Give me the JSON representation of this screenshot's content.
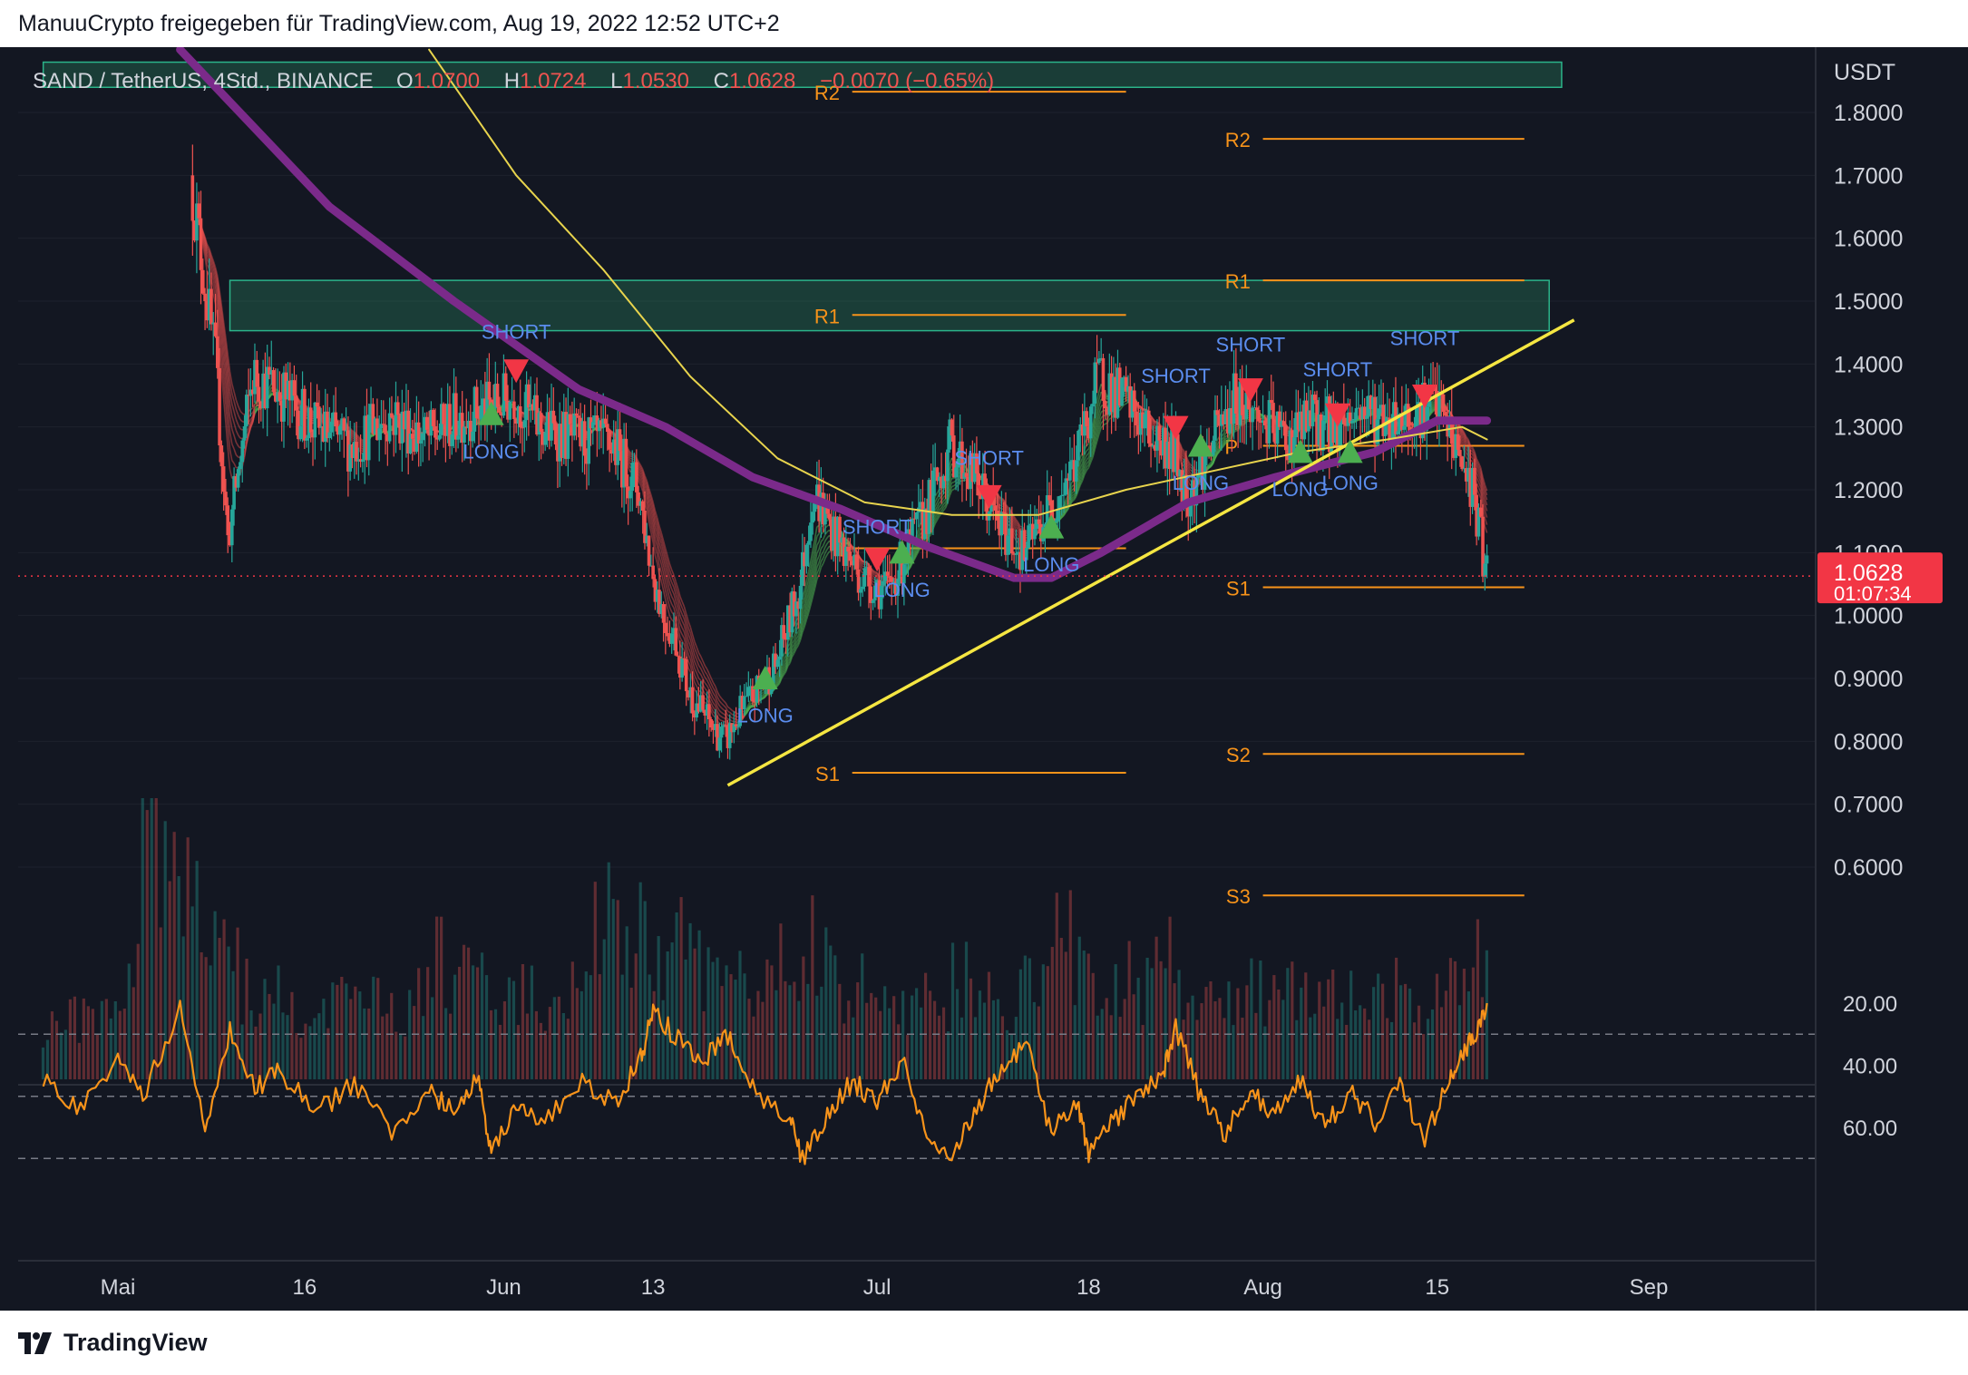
{
  "header": {
    "attribution": "ManuuCrypto freigegeben für TradingView.com, Aug 19, 2022 12:52 UTC+2"
  },
  "legend": {
    "symbol": "SAND / TetherUS, 4Std., BINANCE",
    "o_label": "O",
    "o_value": "1.0700",
    "h_label": "H",
    "h_value": "1.0724",
    "l_label": "L",
    "l_value": "1.0530",
    "c_label": "C",
    "c_value": "1.0628",
    "change": "−0.0070 (−0.65%)"
  },
  "price_axis": {
    "currency": "USDT",
    "ticks": [
      "1.8000",
      "1.7000",
      "1.6000",
      "1.5000",
      "1.4000",
      "1.3000",
      "1.2000",
      "1.1000",
      "1.0000",
      "0.9000",
      "0.8000",
      "0.7000",
      "0.6000"
    ],
    "current_price": "1.0628",
    "countdown": "01:07:34"
  },
  "rsi_axis": {
    "ticks": [
      "60.00",
      "40.00",
      "20.00"
    ]
  },
  "time_axis": {
    "ticks": [
      "Mai",
      "16",
      "Jun",
      "13",
      "Jul",
      "18",
      "Aug",
      "15",
      "Sep"
    ]
  },
  "footer": {
    "brand": "TradingView"
  },
  "colors": {
    "background": "#131722",
    "bull": "#26a69a",
    "bear": "#ef5350",
    "pivot": "#f7931a",
    "signal_text": "#5b8def",
    "trendline": "#f5e642",
    "ma_purple": "#7b2a8a",
    "ma_yellow": "#e8d44d",
    "rsi": "#f7931a",
    "last_price": "#f23645"
  },
  "chart_data": {
    "type": "candlestick",
    "title": "SAND / TetherUS, 4Std., BINANCE",
    "ylabel": "USDT",
    "ylim": [
      0.52,
      1.88
    ],
    "x": [
      "2022-05-01",
      "2022-09-01"
    ],
    "price_path": [
      [
        "2022-04-25",
        1.95
      ],
      [
        "2022-04-30",
        1.92
      ],
      [
        "2022-05-04",
        1.9
      ],
      [
        "2022-05-06",
        1.85
      ],
      [
        "2022-05-07",
        1.7
      ],
      [
        "2022-05-08",
        1.55
      ],
      [
        "2022-05-09",
        1.4
      ],
      [
        "2022-05-10",
        1.12
      ],
      [
        "2022-05-11",
        1.25
      ],
      [
        "2022-05-12",
        1.38
      ],
      [
        "2022-05-14",
        1.36
      ],
      [
        "2022-05-17",
        1.3
      ],
      [
        "2022-05-20",
        1.27
      ],
      [
        "2022-05-23",
        1.32
      ],
      [
        "2022-05-26",
        1.28
      ],
      [
        "2022-05-29",
        1.32
      ],
      [
        "2022-05-31",
        1.33
      ],
      [
        "2022-06-02",
        1.35
      ],
      [
        "2022-06-04",
        1.3
      ],
      [
        "2022-06-07",
        1.28
      ],
      [
        "2022-06-10",
        1.27
      ],
      [
        "2022-06-12",
        1.2
      ],
      [
        "2022-06-13",
        1.08
      ],
      [
        "2022-06-14",
        1.0
      ],
      [
        "2022-06-15",
        0.96
      ],
      [
        "2022-06-16",
        0.88
      ],
      [
        "2022-06-18",
        0.82
      ],
      [
        "2022-06-19",
        0.8
      ],
      [
        "2022-06-20",
        0.84
      ],
      [
        "2022-06-23",
        0.92
      ],
      [
        "2022-06-25",
        1.05
      ],
      [
        "2022-06-26",
        1.2
      ],
      [
        "2022-06-28",
        1.12
      ],
      [
        "2022-06-30",
        1.06
      ],
      [
        "2022-07-02",
        1.04
      ],
      [
        "2022-07-05",
        1.16
      ],
      [
        "2022-07-07",
        1.27
      ],
      [
        "2022-07-09",
        1.22
      ],
      [
        "2022-07-11",
        1.14
      ],
      [
        "2022-07-13",
        1.1
      ],
      [
        "2022-07-15",
        1.17
      ],
      [
        "2022-07-17",
        1.24
      ],
      [
        "2022-07-19",
        1.38
      ],
      [
        "2022-07-21",
        1.34
      ],
      [
        "2022-07-23",
        1.29
      ],
      [
        "2022-07-25",
        1.26
      ],
      [
        "2022-07-26",
        1.19
      ],
      [
        "2022-07-28",
        1.27
      ],
      [
        "2022-07-30",
        1.35
      ],
      [
        "2022-08-01",
        1.31
      ],
      [
        "2022-08-03",
        1.28
      ],
      [
        "2022-08-05",
        1.31
      ],
      [
        "2022-08-07",
        1.3
      ],
      [
        "2022-08-09",
        1.33
      ],
      [
        "2022-08-11",
        1.31
      ],
      [
        "2022-08-13",
        1.32
      ],
      [
        "2022-08-15",
        1.34
      ],
      [
        "2022-08-16",
        1.3
      ],
      [
        "2022-08-17",
        1.25
      ],
      [
        "2022-08-18",
        1.2
      ],
      [
        "2022-08-18T20:00",
        1.1
      ],
      [
        "2022-08-19",
        1.0628
      ]
    ],
    "ma_slow": [
      [
        "2022-05-06",
        1.9
      ],
      [
        "2022-05-18",
        1.65
      ],
      [
        "2022-05-28",
        1.5
      ],
      [
        "2022-06-07",
        1.36
      ],
      [
        "2022-06-14",
        1.3
      ],
      [
        "2022-06-21",
        1.22
      ],
      [
        "2022-06-28",
        1.17
      ],
      [
        "2022-07-05",
        1.11
      ],
      [
        "2022-07-12",
        1.06
      ],
      [
        "2022-07-15",
        1.06
      ],
      [
        "2022-07-19",
        1.1
      ],
      [
        "2022-07-26",
        1.18
      ],
      [
        "2022-08-02",
        1.22
      ],
      [
        "2022-08-10",
        1.26
      ],
      [
        "2022-08-15",
        1.31
      ],
      [
        "2022-08-19",
        1.31
      ]
    ],
    "ma_yellow": [
      [
        "2022-05-26",
        1.9
      ],
      [
        "2022-06-02",
        1.7
      ],
      [
        "2022-06-09",
        1.55
      ],
      [
        "2022-06-16",
        1.38
      ],
      [
        "2022-06-23",
        1.25
      ],
      [
        "2022-06-30",
        1.18
      ],
      [
        "2022-07-07",
        1.16
      ],
      [
        "2022-07-14",
        1.16
      ],
      [
        "2022-07-21",
        1.2
      ],
      [
        "2022-07-28",
        1.23
      ],
      [
        "2022-08-04",
        1.26
      ],
      [
        "2022-08-11",
        1.28
      ],
      [
        "2022-08-17",
        1.3
      ],
      [
        "2022-08-19",
        1.28
      ]
    ],
    "supply_zones": [
      {
        "x0": "2022-04-25",
        "x1": "2022-08-25",
        "y0": 1.84,
        "y1": 1.88
      },
      {
        "x0": "2022-05-10",
        "x1": "2022-08-24",
        "y0": 1.453,
        "y1": 1.533
      }
    ],
    "trendline": {
      "x0": "2022-06-19",
      "y0": 0.73,
      "x1": "2022-08-26",
      "y1": 1.47
    },
    "pivots": [
      {
        "label": "R2",
        "x0": "2022-06-29",
        "x1": "2022-07-21",
        "y": 1.833,
        "text_x": "2022-06-28"
      },
      {
        "label": "R1",
        "x0": "2022-06-29",
        "x1": "2022-07-21",
        "y": 1.478,
        "text_x": "2022-06-28"
      },
      {
        "label": "P",
        "x0": "2022-06-29",
        "x1": "2022-07-21",
        "y": 1.107,
        "text_x": "2022-06-29"
      },
      {
        "label": "S1",
        "x0": "2022-06-29",
        "x1": "2022-07-21",
        "y": 0.75,
        "text_x": "2022-06-28"
      },
      {
        "label": "R2",
        "x0": "2022-08-01",
        "x1": "2022-08-22",
        "y": 1.758,
        "text_x": "2022-07-31"
      },
      {
        "label": "R1",
        "x0": "2022-08-01",
        "x1": "2022-08-22",
        "y": 1.533,
        "text_x": "2022-07-31"
      },
      {
        "label": "P",
        "x0": "2022-08-01",
        "x1": "2022-08-22",
        "y": 1.27,
        "text_x": "2022-07-30"
      },
      {
        "label": "S1",
        "x0": "2022-08-01",
        "x1": "2022-08-22",
        "y": 1.045,
        "text_x": "2022-07-31"
      },
      {
        "label": "S2",
        "x0": "2022-08-01",
        "x1": "2022-08-22",
        "y": 0.78,
        "text_x": "2022-07-31"
      },
      {
        "label": "S3",
        "x0": "2022-08-01",
        "x1": "2022-08-22",
        "y": 0.555,
        "text_x": "2022-07-31"
      }
    ],
    "signals": [
      {
        "type": "LONG",
        "x": "2022-05-31",
        "y": 1.32,
        "label_y": 1.25
      },
      {
        "type": "SHORT",
        "x": "2022-06-02",
        "y": 1.39,
        "label_y": 1.44
      },
      {
        "type": "LONG",
        "x": "2022-06-22",
        "y": 0.9,
        "label_y": 0.83
      },
      {
        "type": "SHORT",
        "x": "2022-07-01",
        "y": 1.09,
        "label_y": 1.13
      },
      {
        "type": "LONG",
        "x": "2022-07-03",
        "y": 1.1,
        "label_y": 1.03
      },
      {
        "type": "SHORT",
        "x": "2022-07-10",
        "y": 1.19,
        "label_y": 1.24
      },
      {
        "type": "LONG",
        "x": "2022-07-15",
        "y": 1.14,
        "label_y": 1.07
      },
      {
        "type": "SHORT",
        "x": "2022-07-25",
        "y": 1.3,
        "label_y": 1.37
      },
      {
        "type": "LONG",
        "x": "2022-07-27",
        "y": 1.27,
        "label_y": 1.2
      },
      {
        "type": "SHORT",
        "x": "2022-07-31",
        "y": 1.36,
        "label_y": 1.42
      },
      {
        "type": "LONG",
        "x": "2022-08-04",
        "y": 1.26,
        "label_y": 1.19
      },
      {
        "type": "SHORT",
        "x": "2022-08-07",
        "y": 1.32,
        "label_y": 1.38
      },
      {
        "type": "LONG",
        "x": "2022-08-08",
        "y": 1.26,
        "label_y": 1.2
      },
      {
        "type": "SHORT",
        "x": "2022-08-14",
        "y": 1.35,
        "label_y": 1.43
      }
    ],
    "volume": [
      0.18,
      0.22,
      0.2,
      0.35,
      0.95,
      0.8,
      0.6,
      0.45,
      0.3,
      0.28,
      0.26,
      0.24,
      0.3,
      0.28,
      0.25,
      0.3,
      0.4,
      0.34,
      0.28,
      0.3,
      0.22,
      0.35,
      0.6,
      0.55,
      0.5,
      0.45,
      0.4,
      0.38,
      0.35,
      0.3,
      0.42,
      0.5,
      0.35,
      0.32,
      0.3,
      0.28,
      0.26,
      0.35,
      0.3,
      0.28,
      0.32,
      0.5,
      0.4,
      0.3,
      0.35,
      0.4,
      0.3,
      0.28,
      0.26,
      0.3,
      0.35,
      0.3,
      0.28,
      0.3,
      0.32,
      0.3,
      0.28,
      0.3,
      0.4
    ],
    "rsi": {
      "ylim": [
        18,
        74
      ],
      "bands": [
        70,
        50,
        30
      ],
      "values": [
        [
          "2022-04-25",
          45
        ],
        [
          "2022-04-28",
          55
        ],
        [
          "2022-05-01",
          38
        ],
        [
          "2022-05-03",
          50
        ],
        [
          "2022-05-06",
          22
        ],
        [
          "2022-05-08",
          60
        ],
        [
          "2022-05-10",
          28
        ],
        [
          "2022-05-12",
          47
        ],
        [
          "2022-05-14",
          42
        ],
        [
          "2022-05-17",
          55
        ],
        [
          "2022-05-20",
          46
        ],
        [
          "2022-05-23",
          62
        ],
        [
          "2022-05-26",
          48
        ],
        [
          "2022-05-28",
          55
        ],
        [
          "2022-05-30",
          44
        ],
        [
          "2022-05-31",
          70
        ],
        [
          "2022-06-02",
          52
        ],
        [
          "2022-06-04",
          60
        ],
        [
          "2022-06-07",
          45
        ],
        [
          "2022-06-10",
          52
        ],
        [
          "2022-06-12",
          38
        ],
        [
          "2022-06-13",
          22
        ],
        [
          "2022-06-15",
          32
        ],
        [
          "2022-06-17",
          38
        ],
        [
          "2022-06-19",
          30
        ],
        [
          "2022-06-21",
          48
        ],
        [
          "2022-06-24",
          58
        ],
        [
          "2022-06-25",
          70
        ],
        [
          "2022-06-27",
          56
        ],
        [
          "2022-06-29",
          45
        ],
        [
          "2022-07-01",
          52
        ],
        [
          "2022-07-03",
          38
        ],
        [
          "2022-07-05",
          62
        ],
        [
          "2022-07-07",
          68
        ],
        [
          "2022-07-09",
          55
        ],
        [
          "2022-07-11",
          40
        ],
        [
          "2022-07-13",
          34
        ],
        [
          "2022-07-15",
          62
        ],
        [
          "2022-07-17",
          52
        ],
        [
          "2022-07-18",
          68
        ],
        [
          "2022-07-20",
          58
        ],
        [
          "2022-07-22",
          50
        ],
        [
          "2022-07-24",
          42
        ],
        [
          "2022-07-25",
          28
        ],
        [
          "2022-07-27",
          50
        ],
        [
          "2022-07-29",
          62
        ],
        [
          "2022-07-31",
          48
        ],
        [
          "2022-08-02",
          56
        ],
        [
          "2022-08-04",
          45
        ],
        [
          "2022-08-06",
          60
        ],
        [
          "2022-08-08",
          48
        ],
        [
          "2022-08-10",
          58
        ],
        [
          "2022-08-12",
          46
        ],
        [
          "2022-08-14",
          64
        ],
        [
          "2022-08-16",
          45
        ],
        [
          "2022-08-17",
          36
        ],
        [
          "2022-08-18",
          30
        ],
        [
          "2022-08-19",
          20
        ]
      ]
    }
  }
}
